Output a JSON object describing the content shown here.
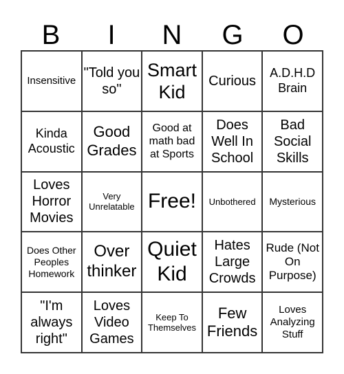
{
  "header": [
    "B",
    "I",
    "N",
    "G",
    "O"
  ],
  "cells": [
    {
      "text": "Insensitive",
      "size": 15
    },
    {
      "text": "\"Told you so\"",
      "size": 20
    },
    {
      "text": "Smart Kid",
      "size": 27
    },
    {
      "text": "Curious",
      "size": 20
    },
    {
      "text": "A.D.H.D Brain",
      "size": 18
    },
    {
      "text": "Kinda Acoustic",
      "size": 18
    },
    {
      "text": "Good Grades",
      "size": 22
    },
    {
      "text": "Good at math bad at Sports",
      "size": 16
    },
    {
      "text": "Does Well In School",
      "size": 20
    },
    {
      "text": "Bad Social Skills",
      "size": 20
    },
    {
      "text": "Loves Horror Movies",
      "size": 20
    },
    {
      "text": "Very Unrelatable",
      "size": 13
    },
    {
      "text": "Free!",
      "size": 30
    },
    {
      "text": "Unbothered",
      "size": 13
    },
    {
      "text": "Mysterious",
      "size": 14
    },
    {
      "text": "Does Other Peoples Homework",
      "size": 14
    },
    {
      "text": "Over thinker",
      "size": 24
    },
    {
      "text": "Quiet Kid",
      "size": 30
    },
    {
      "text": "Hates Large Crowds",
      "size": 20
    },
    {
      "text": "Rude (Not On Purpose)",
      "size": 17
    },
    {
      "text": "\"I'm always right\"",
      "size": 20
    },
    {
      "text": "Loves Video Games",
      "size": 20
    },
    {
      "text": "Keep To Themselves",
      "size": 13
    },
    {
      "text": "Few Friends",
      "size": 22
    },
    {
      "text": "Loves Analyzing Stuff",
      "size": 15
    }
  ]
}
